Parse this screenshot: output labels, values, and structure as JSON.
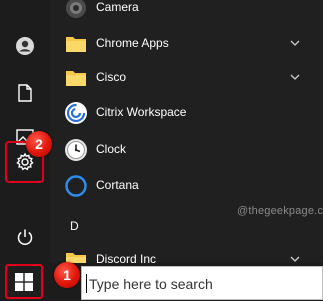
{
  "colors": {
    "highlight": "#e0001b",
    "badge": "#e0150a",
    "folder": "#f7c948",
    "background": "#202020",
    "rail": "#1c1c1c"
  },
  "rail": {
    "items": [
      {
        "name": "user-account",
        "icon": "user-icon"
      },
      {
        "name": "documents",
        "icon": "document-icon"
      },
      {
        "name": "pictures",
        "icon": "picture-icon"
      },
      {
        "name": "settings",
        "icon": "gear-icon"
      },
      {
        "name": "power",
        "icon": "power-icon"
      }
    ]
  },
  "apps": {
    "items": [
      {
        "label": "Camera",
        "icon": "camera-icon",
        "expandable": false
      },
      {
        "label": "Chrome Apps",
        "icon": "folder-icon",
        "expandable": true
      },
      {
        "label": "Cisco",
        "icon": "folder-icon",
        "expandable": true
      },
      {
        "label": "Citrix Workspace",
        "icon": "citrix-icon",
        "expandable": false
      },
      {
        "label": "Clock",
        "icon": "clock-icon",
        "expandable": false
      },
      {
        "label": "Cortana",
        "icon": "cortana-icon",
        "expandable": false
      },
      {
        "label": "Discord Inc",
        "icon": "folder-icon",
        "expandable": true
      }
    ],
    "section_letter": "D"
  },
  "watermark": "@thegeekpage.com",
  "search": {
    "placeholder": "Type here to search",
    "value": ""
  },
  "taskbar": {
    "start_icon": "windows-logo-icon"
  },
  "annotations": {
    "step1": "1",
    "step2": "2"
  }
}
